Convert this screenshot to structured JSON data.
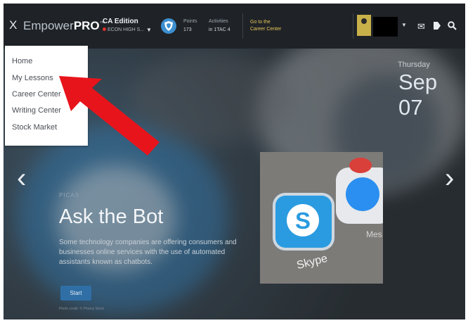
{
  "header": {
    "close_glyph": "X",
    "brand_light": "Empower",
    "brand_bold": "PRO",
    "brand_tm": "™",
    "edition": "CA Edition",
    "school": "ECON HIGH S...",
    "points_label": "Points",
    "points_value": "173",
    "activities_label": "Activities",
    "activities_value": "in 1TAC 4",
    "go_to_line1": "Go to the",
    "go_to_line2": "Career Center"
  },
  "menu": {
    "items": [
      "Home",
      "My Lessons",
      "Career Center",
      "Writing Center",
      "Stock Market"
    ]
  },
  "date": {
    "day": "Thursday",
    "date": "Sep 07"
  },
  "hero": {
    "tag": "PICAS",
    "title": "Ask the Bot",
    "description": "Some technology companies are offering consumers and businesses online services with the use of automated assistants known as chatbots.",
    "start_label": "Start",
    "credit": "Photo credit: © Photos Stock"
  },
  "photo": {
    "skype_label": "Skype",
    "messenger_label": "Mes"
  },
  "icons": {
    "close": "close-icon",
    "shield": "shield-badge-icon",
    "mail": "mail-icon",
    "tag": "tag-icon",
    "search": "search-icon",
    "prev": "chevron-left-icon",
    "next": "chevron-right-icon"
  },
  "colors": {
    "topbar": "#1f2327",
    "accent_blue": "#3c8fd0",
    "link_gold": "#e7c45a",
    "arrow_red": "#e8141c",
    "start_button": "#2f6fa6"
  }
}
